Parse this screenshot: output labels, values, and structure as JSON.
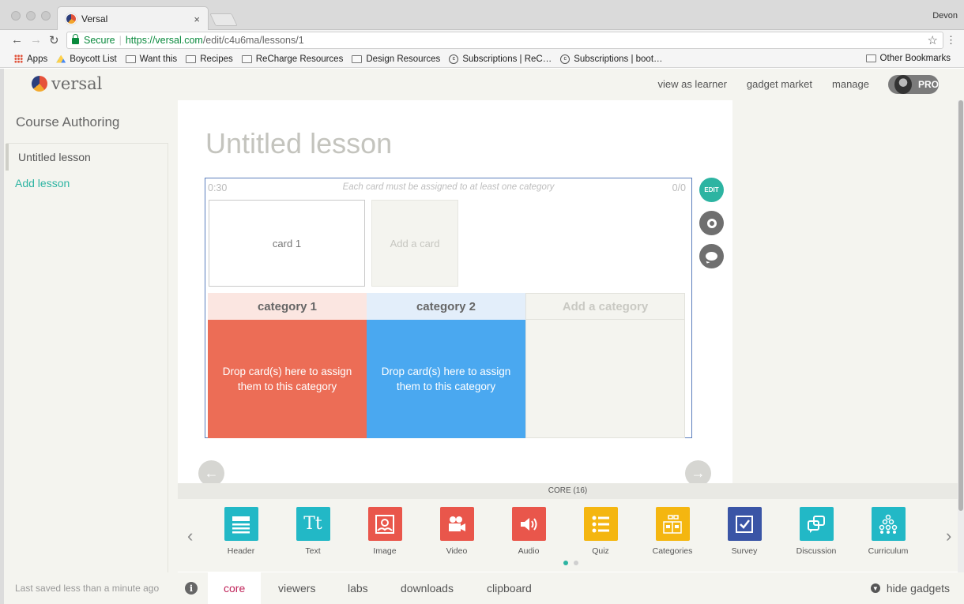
{
  "browser": {
    "tab_title": "Versal",
    "tab_close": "×",
    "profile": "Devon",
    "secure_label": "Secure",
    "url_host": "https://versal.com",
    "url_path": "/edit/c4u6ma/lessons/1",
    "bookmarks": [
      "Apps",
      "Boycott List",
      "Want this",
      "Recipes",
      "ReCharge Resources",
      "Design Resources",
      "Subscriptions | ReC…",
      "Subscriptions | boot…"
    ],
    "other_bookmarks": "Other Bookmarks"
  },
  "app": {
    "logo": "versal",
    "nav": [
      "view as learner",
      "gadget market",
      "manage"
    ],
    "badge": "PRO"
  },
  "sidebar": {
    "title": "Course Authoring",
    "lesson": "Untitled lesson",
    "add_lesson": "Add lesson"
  },
  "lesson": {
    "title": "Untitled lesson",
    "gadget": {
      "timer": "0:30",
      "instructions": "Each card must be assigned to at least one category",
      "score": "0/0",
      "card": "card 1",
      "add_card": "Add a card",
      "categories": [
        {
          "name": "category 1",
          "head_color": "#fbe6e1",
          "body_color": "#ec6d56",
          "drop_text": "Drop card(s) here to assign them to this category"
        },
        {
          "name": "category 2",
          "head_color": "#e3eefa",
          "body_color": "#4aa8f0",
          "drop_text": "Drop card(s) here to assign them to this category"
        }
      ],
      "add_category": "Add a category"
    },
    "edit_label": "EDIT"
  },
  "tray": {
    "heading": "CORE (16)",
    "gadgets": [
      {
        "label": "Header",
        "icon": "header-icon",
        "color": "#22b8c6"
      },
      {
        "label": "Text",
        "icon": "text-icon",
        "color": "#22b8c6"
      },
      {
        "label": "Image",
        "icon": "image-icon",
        "color": "#e9564b"
      },
      {
        "label": "Video",
        "icon": "video-icon",
        "color": "#e9564b"
      },
      {
        "label": "Audio",
        "icon": "audio-icon",
        "color": "#e9564b"
      },
      {
        "label": "Quiz",
        "icon": "quiz-icon",
        "color": "#f4b610"
      },
      {
        "label": "Categories",
        "icon": "categories-icon",
        "color": "#f4b610"
      },
      {
        "label": "Survey",
        "icon": "survey-icon",
        "color": "#3a55a6"
      },
      {
        "label": "Discussion",
        "icon": "discussion-icon",
        "color": "#22b8c6"
      },
      {
        "label": "Curriculum",
        "icon": "curriculum-icon",
        "color": "#22b8c6"
      }
    ]
  },
  "footer": {
    "saved": "Last saved less than a minute ago",
    "tabs": [
      "core",
      "viewers",
      "labs",
      "downloads",
      "clipboard"
    ],
    "active_tab": "core",
    "hide_gadgets": "hide gadgets"
  },
  "colors": {
    "accent": "#2db4a2",
    "active_tab": "#c0245a"
  }
}
